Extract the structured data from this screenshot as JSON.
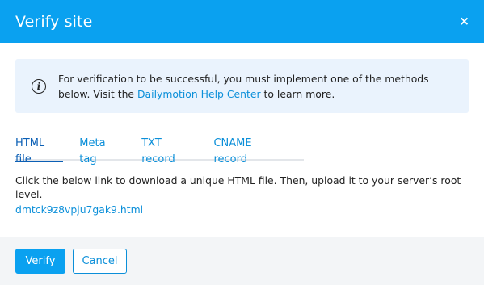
{
  "dialog": {
    "title": "Verify site",
    "close_label": "×"
  },
  "info": {
    "icon": "info-icon",
    "text_before": "For verification to be successful, you must implement one of the methods below. Visit the ",
    "link_text": "Dailymotion Help Center",
    "text_after": " to learn more."
  },
  "tabs": [
    {
      "label": "HTML file",
      "active": true
    },
    {
      "label": "Meta tag",
      "active": false
    },
    {
      "label": "TXT record",
      "active": false
    },
    {
      "label": "CNAME record",
      "active": false
    }
  ],
  "content": {
    "description": "Click the below link to download a unique HTML file. Then, upload it to your server’s root level.",
    "file_link": "dmtck9z8vpju7gak9.html"
  },
  "footer": {
    "verify_label": "Verify",
    "cancel_label": "Cancel"
  },
  "colors": {
    "accent": "#0aa1f0",
    "link": "#0b8fd9",
    "info_bg": "#eaf3fd",
    "footer_bg": "#f3f5f7"
  }
}
